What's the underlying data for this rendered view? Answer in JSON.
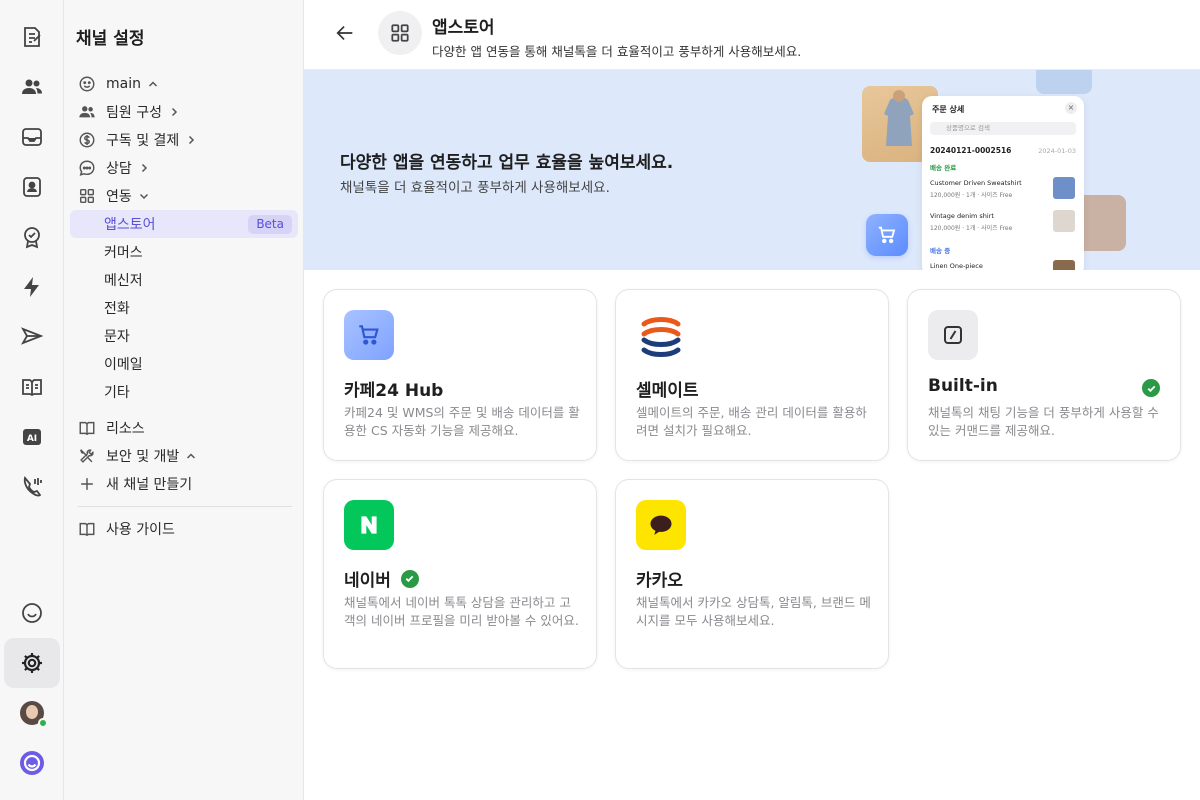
{
  "sidebar": {
    "title": "채널 설정",
    "items": [
      {
        "label": "main",
        "icon": "smile-icon"
      },
      {
        "label": "팀원 구성",
        "icon": "team-icon"
      },
      {
        "label": "구독 및 결제",
        "icon": "dollar-icon"
      },
      {
        "label": "상담",
        "icon": "chat-icon"
      },
      {
        "label": "연동",
        "icon": "grid-icon"
      },
      {
        "label": "앱스토어",
        "badge": "Beta"
      },
      {
        "label": "커머스"
      },
      {
        "label": "메신저"
      },
      {
        "label": "전화"
      },
      {
        "label": "문자"
      },
      {
        "label": "이메일"
      },
      {
        "label": "기타"
      },
      {
        "label": "리소스",
        "icon": "book-icon"
      },
      {
        "label": "보안 및 개발",
        "icon": "tools-icon"
      },
      {
        "label": "새 채널 만들기",
        "icon": "plus-icon"
      },
      {
        "label": "사용 가이드",
        "icon": "guide-icon"
      }
    ]
  },
  "header": {
    "title": "앱스토어",
    "subtitle": "다양한 앱 연동을 통해 채널톡을 더 효율적이고 풍부하게 사용해보세요."
  },
  "banner": {
    "title": "다양한 앱을 연동하고 업무 효율을 높여보세요.",
    "subtitle": "채널톡을 더 효율적이고 풍부하게 사용해보세요.",
    "mock": {
      "header": "주문 상세",
      "search_placeholder": "상품명으로 검색",
      "order_id": "20240121-0002516",
      "date": "2024-01-03",
      "status1": "배송 완료",
      "item1": "Customer Driven Sweatshirt",
      "item1_meta": "120,000원 · 1개 · 사이즈 Free",
      "item2": "Vintage denim shirt",
      "item2_meta": "120,000원 · 1개 · 사이즈 Free",
      "status2": "배송 중",
      "item3": "Linen One-piece"
    }
  },
  "apps": [
    {
      "name": "카페24 Hub",
      "desc": "카페24 및 WMS의 주문 및 배송 데이터를 활용한 CS 자동화 기능을 제공해요.",
      "installed": false,
      "icon": "cart-icon",
      "color": "#8fb2ff"
    },
    {
      "name": "셀메이트",
      "desc": "셀메이트의 주문, 배송 관리 데이터를 활용하려면 설치가 필요해요.",
      "installed": false,
      "icon": "sellmate-logo",
      "color": "#e8591a"
    },
    {
      "name": "Built-in",
      "desc": "채널톡의 채팅 기능을 더 풍부하게 사용할 수 있는 커맨드를 제공해요.",
      "installed": true,
      "icon": "slash-command-icon",
      "color": "#ececee"
    },
    {
      "name": "네이버",
      "desc": "채널톡에서 네이버 톡톡 상담을 관리하고 고객의 네이버 프로필을 미리 받아볼 수 있어요.",
      "installed": true,
      "icon": "naver-logo",
      "color": "#03c75a"
    },
    {
      "name": "카카오",
      "desc": "채널톡에서 카카오 상담톡, 알림톡, 브랜드 메시지를 모두 사용해보세요.",
      "installed": false,
      "icon": "kakao-logo",
      "color": "#fee500"
    }
  ]
}
